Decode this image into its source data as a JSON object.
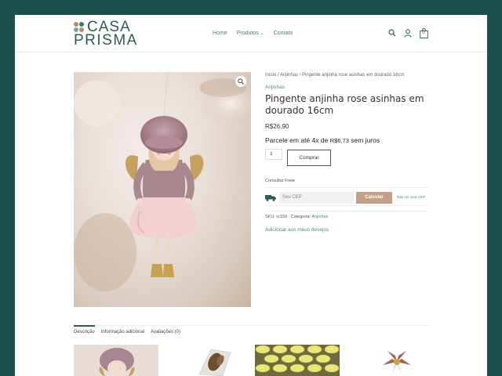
{
  "brand": {
    "line1": "CASA",
    "line2": "PRISMA",
    "colors": [
      "#c2876a",
      "#3b7a72",
      "#6fa8a0",
      "#c2876a"
    ]
  },
  "nav": {
    "items": [
      "Home",
      "Produtos",
      "Contato"
    ]
  },
  "header_icons": [
    "search-icon",
    "user-icon",
    "cart-icon"
  ],
  "cart": {
    "count": "0"
  },
  "product": {
    "breadcrumb": "Início / Anjinhas / Pingente anjinha rose asinhas em dourado 16cm",
    "category": "Anjinhas",
    "title": "Pingente anjinha rose asinhas em dourado 16cm",
    "price": "R$26,90",
    "installment_prefix": "Parcele em até 4x de",
    "installment_amount": "R$6,73",
    "installment_suffix": "sem juros",
    "quantity": "1",
    "buy_label": "Comprar"
  },
  "shipping": {
    "label": "Consultar Frete",
    "cep_placeholder": "Seu CEP",
    "calc_label": "Calcular",
    "no_cep_link": "Não sei meu CEP"
  },
  "meta": {
    "sku_label": "SKU:",
    "sku": "cr150",
    "category_label": "Categoria:",
    "category": "Anjinhas"
  },
  "wishlist_label": "Adicionar aos meus desejos",
  "tabs": [
    "Descrição",
    "Informação adicional",
    "Avaliações (0)"
  ],
  "colors": {
    "frame": "#1a4f4a",
    "accent": "#2d5c58",
    "link": "#4b8a84",
    "button": "#c59f86"
  }
}
